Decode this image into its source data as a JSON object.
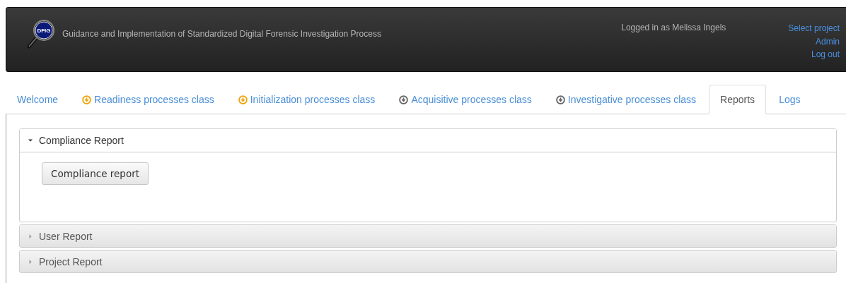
{
  "header": {
    "title": "Guidance and Implementation of Standardized Digital Forensic Investigation Process",
    "logo_text": "DFIG",
    "user": "Logged in as Melissa Ingels",
    "links": [
      "Select project",
      "Admin",
      "Log out"
    ]
  },
  "tabs": [
    {
      "label": "Welcome",
      "selected": false
    },
    {
      "label": "Readiness processes class",
      "selected": false,
      "color": "#f0a30a"
    },
    {
      "label": "Initialization processes class",
      "selected": false,
      "color": "#f0a30a"
    },
    {
      "label": "Acquisitive processes class",
      "selected": false,
      "color": "#666666"
    },
    {
      "label": "Investigative processes class",
      "selected": false,
      "color": "#666666"
    },
    {
      "label": "Reports",
      "selected": true
    },
    {
      "label": "Logs",
      "selected": false
    }
  ],
  "sections": [
    {
      "title": "Compliance Report",
      "expanded": true,
      "buttons": [
        "Compliance report"
      ]
    },
    {
      "title": "User Report",
      "expanded": false
    },
    {
      "title": "Project Report",
      "expanded": false
    }
  ]
}
